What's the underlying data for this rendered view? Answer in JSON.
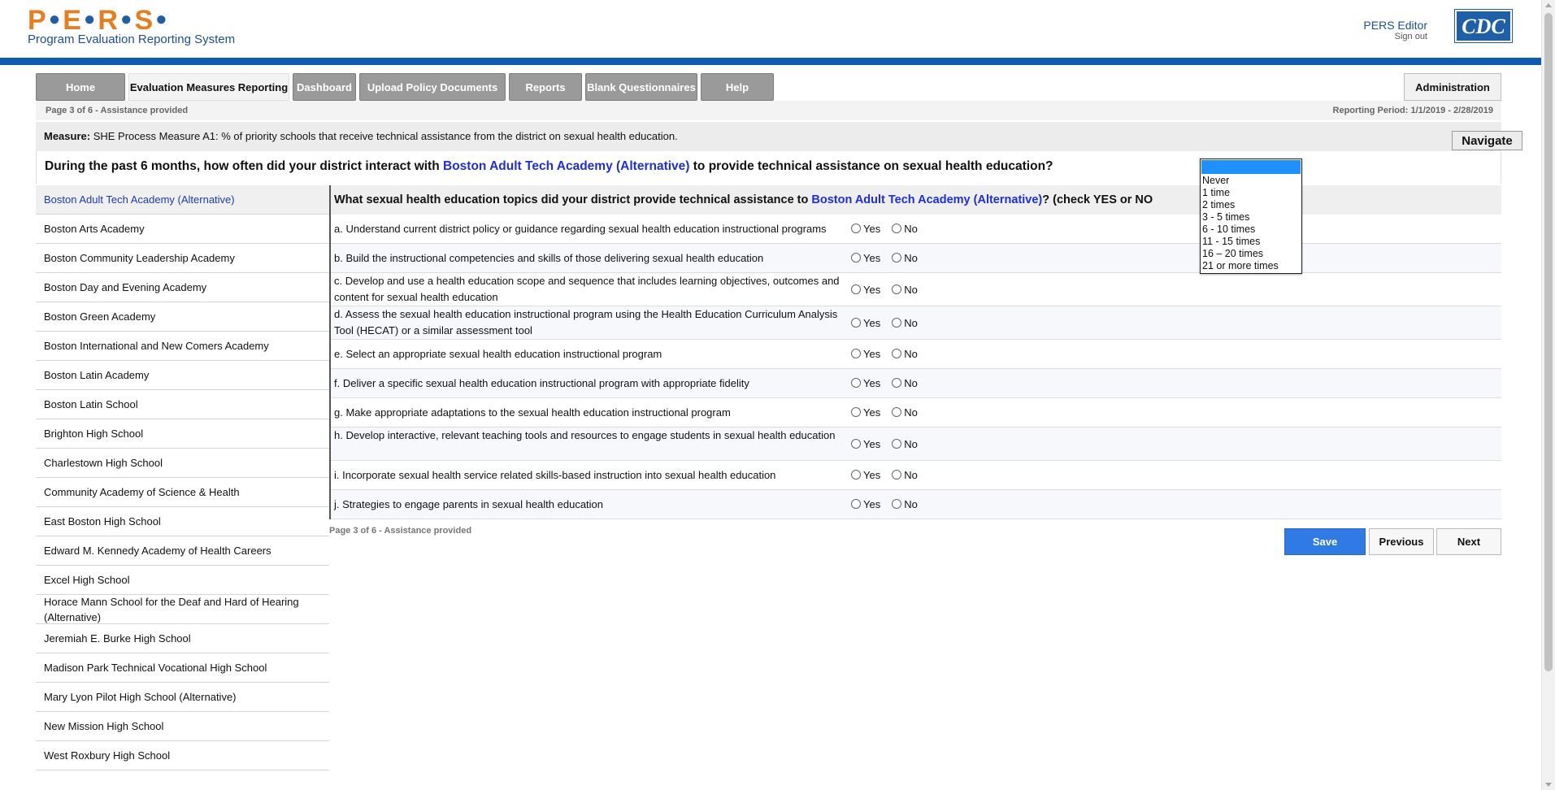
{
  "header": {
    "logo_text": "P·E·R·S",
    "logo_sub": "Program Evaluation Reporting System",
    "user_name": "PERS Editor",
    "sign_out": "Sign out",
    "cdc_logo": "CDC"
  },
  "tabs": [
    {
      "label": "Home"
    },
    {
      "label": "Evaluation Measures Reporting"
    },
    {
      "label": "Dashboard"
    },
    {
      "label": "Upload Policy Documents"
    },
    {
      "label": "Reports"
    },
    {
      "label": "Blank Questionnaires"
    },
    {
      "label": "Help"
    }
  ],
  "admin_label": "Administration",
  "page_info": "Page 3 of 6 - Assistance provided",
  "reporting_period": "Reporting Period: 1/1/2019 - 2/28/2019",
  "measure": {
    "label": "Measure:",
    "text": "SHE Process Measure A1: % of priority schools that receive technical assistance from the district on sexual health education."
  },
  "navigate_label": "Navigate",
  "question": {
    "prefix": "During the past 6 months, how often did your district interact with",
    "school": "Boston Adult Tech Academy (Alternative)",
    "suffix": "to provide technical assistance on sexual health education?"
  },
  "frequency_options": [
    "",
    "Never",
    "1 time",
    "2 times",
    "3 - 5 times",
    "6 - 10 times",
    "11 - 15 times",
    "16 – 20 times",
    "21 or more times"
  ],
  "schools": [
    "Boston Adult Tech Academy (Alternative)",
    "Boston Arts Academy",
    "Boston Community Leadership Academy",
    "Boston Day and Evening Academy",
    "Boston Green Academy",
    "Boston International and New Comers Academy",
    "Boston Latin Academy",
    "Boston Latin School",
    "Brighton High School",
    "Charlestown High School",
    "Community Academy of Science & Health",
    "East Boston High School",
    "Edward M. Kennedy Academy of Health Careers",
    "Excel High School",
    "Horace Mann School for the Deaf and Hard of Hearing (Alternative)",
    "Jeremiah E. Burke High School",
    "Madison Park Technical Vocational High School",
    "Mary Lyon Pilot High School (Alternative)",
    "New Mission High School",
    "West Roxbury High School"
  ],
  "topics_header": {
    "prefix": "What sexual health education topics did your district provide technical assistance to",
    "school": "Boston Adult Tech Academy (Alternative)",
    "suffix": "? (check YES or NO"
  },
  "yes_label": "Yes",
  "no_label": "No",
  "topics": [
    "a. Understand current district policy or guidance regarding sexual health education instructional programs",
    "b. Build the instructional competencies and skills of those delivering sexual health education",
    "c. Develop and use a health education scope and sequence that includes learning objectives, outcomes and content for sexual health education",
    "d. Assess the sexual health education instructional program using the Health Education Curriculum Analysis Tool (HECAT) or a similar assessment tool",
    "e. Select an appropriate sexual health education instructional program",
    "f. Deliver a specific sexual health education instructional program with appropriate fidelity",
    "g. Make appropriate adaptations to the sexual health education instructional program",
    "h. Develop interactive, relevant teaching tools and resources to engage students in sexual health education",
    "i. Incorporate sexual health service related skills-based instruction into sexual health education",
    "j. Strategies to engage parents in sexual health education"
  ],
  "buttons": {
    "save": "Save",
    "previous": "Previous",
    "next": "Next"
  },
  "colors": {
    "brand_orange": "#e87d1e",
    "brand_blue": "#0b5cb5",
    "highlight_blue": "#1d2ee0",
    "save_blue": "#2f7ae5"
  }
}
